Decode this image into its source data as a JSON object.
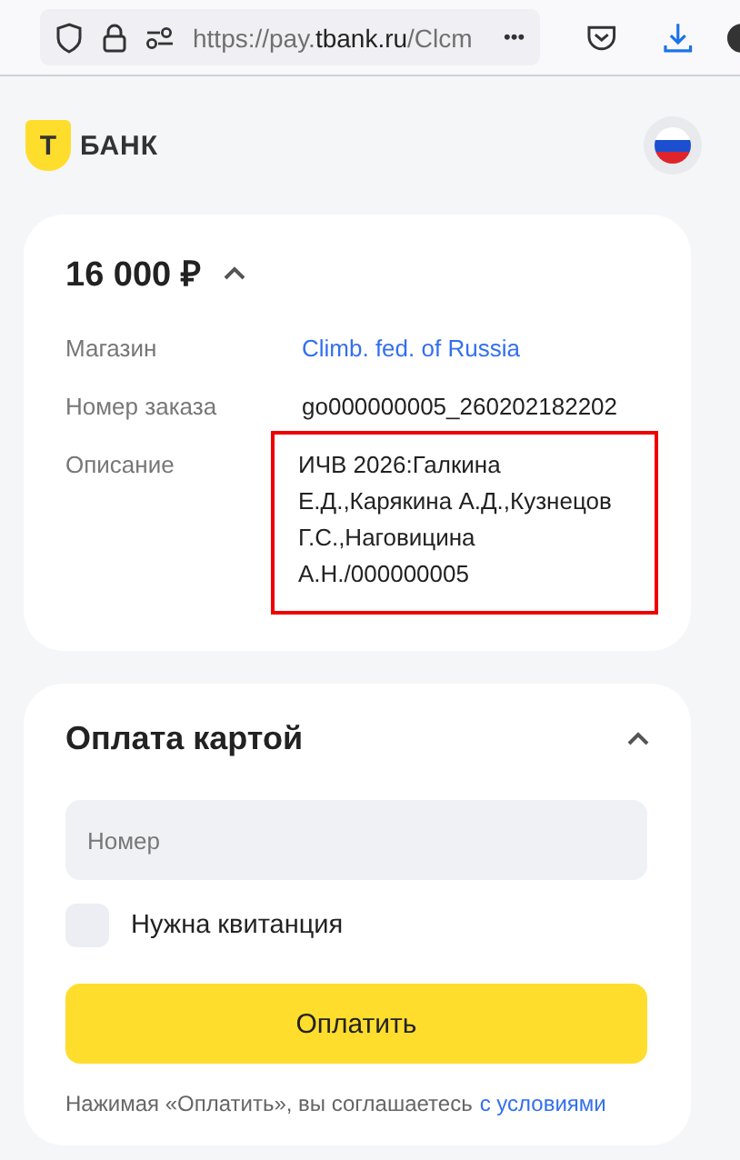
{
  "browser": {
    "url_start": "https://pay.",
    "url_host": "tbank.ru",
    "url_rest": "/Clcm",
    "menu": "•••"
  },
  "header": {
    "logo_mark": "Т",
    "logo_text": "БАНК"
  },
  "order": {
    "amount": "16 000 ₽",
    "expanded": true,
    "details": [
      {
        "label": "Магазин",
        "value": "Climb. fed. of Russia",
        "kind": "link",
        "highlighted": false
      },
      {
        "label": "Номер заказа",
        "value": "go000000005_260202182202",
        "kind": "text",
        "highlighted": false
      },
      {
        "label": "Описание",
        "value": "ИЧВ 2026:Галкина Е.Д.,Карякина А.Д.,Кузнецов Г.С.,Наговицина А.Н./000000005",
        "kind": "text",
        "highlighted": true
      }
    ]
  },
  "payment": {
    "title": "Оплата картой",
    "expanded": true,
    "card_field": {
      "placeholder": "Номер"
    },
    "receipt": {
      "label": "Нужна квитанция",
      "checked": false
    },
    "pay_button": "Оплатить",
    "terms": {
      "text": "Нажимая «Оплатить», вы соглашаетесь",
      "link": "с условиями"
    }
  }
}
